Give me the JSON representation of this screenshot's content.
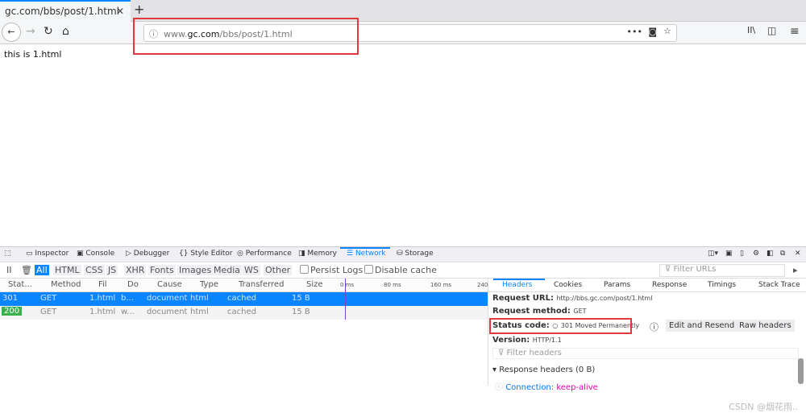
{
  "browser": {
    "tab_title": "gc.com/bbs/post/1.html",
    "new_tab": "+",
    "url_prefix": "www.",
    "url_domain": "gc.com",
    "url_path": "/bbs/post/1.html"
  },
  "page": {
    "content": "this  is  1.html"
  },
  "devtools": {
    "tabs": [
      "Inspector",
      "Console",
      "Debugger",
      "Style Editor",
      "Performance",
      "Memory",
      "Network",
      "Storage"
    ],
    "filters": [
      "All",
      "HTML",
      "CSS",
      "JS",
      "XHR",
      "Fonts",
      "Images",
      "Media",
      "WS",
      "Other"
    ],
    "persist_logs": "Persist Logs",
    "disable_cache": "Disable cache",
    "filter_urls": "Filter URLs",
    "columns": [
      "Stat...",
      "Method",
      "Fil",
      "Do",
      "Cause",
      "Type",
      "Transferred",
      "Size"
    ],
    "timeline": [
      "0 ms",
      "80 ms",
      "160 ms",
      "240"
    ],
    "requests": [
      {
        "status": "301",
        "method": "GET",
        "file": "1.html",
        "domain": "b...",
        "cause": "document",
        "type": "html",
        "transferred": "cached",
        "size": "15 B"
      },
      {
        "status": "200",
        "method": "GET",
        "file": "1.html",
        "domain": "w...",
        "cause": "document",
        "type": "html",
        "transferred": "cached",
        "size": "15 B"
      }
    ],
    "panel": {
      "tabs": [
        "Headers",
        "Cookies",
        "Params",
        "Response",
        "Timings",
        "Stack Trace"
      ],
      "request_url_label": "Request URL:",
      "request_url": "http://bbs.gc.com/post/1.html",
      "method_label": "Request method:",
      "method": "GET",
      "status_label": "Status code:",
      "status": "301 Moved Permanently",
      "edit_resend": "Edit and Resend",
      "raw_headers": "Raw headers",
      "version_label": "Version:",
      "version": "HTTP/1.1",
      "filter_headers": "Filter headers",
      "response_headers": "Response headers (0 B)",
      "conn_key": "Connection:",
      "conn_val": "keep-alive"
    }
  },
  "watermark": "CSDN @烟花雨..",
  "colors": {
    "accent": "#0a84ff",
    "highlight": "#e0393e",
    "ok": "#37b24d"
  }
}
